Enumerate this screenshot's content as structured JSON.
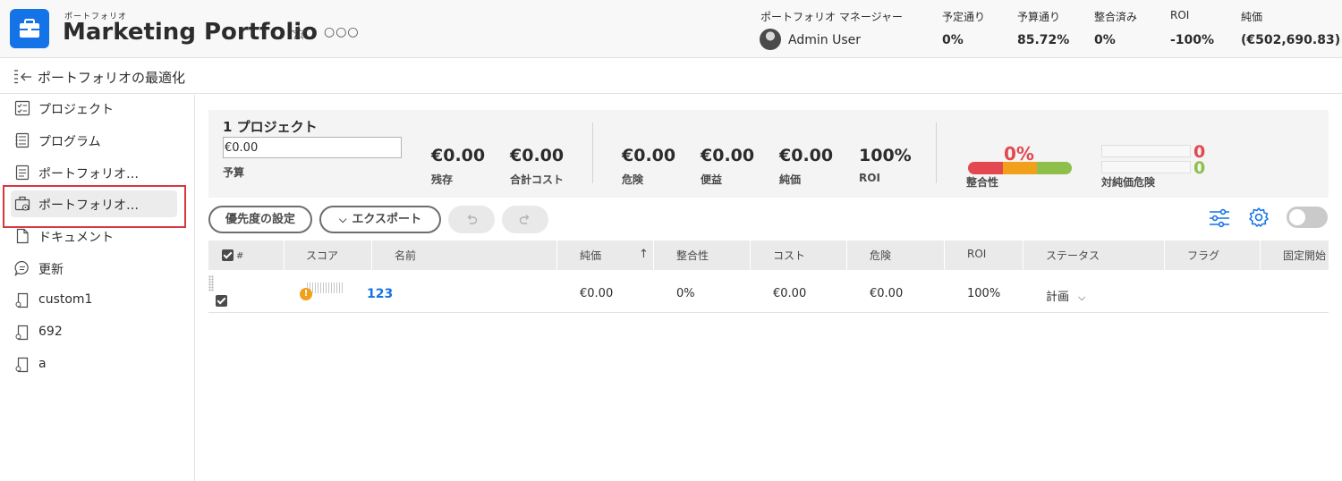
{
  "header": {
    "object_type": "ポートフォリオ",
    "title": "Marketing Portfolio",
    "manager_label": "ポートフォリオ マネージャー",
    "manager_name": "Admin User",
    "stats": [
      {
        "label": "予定通り",
        "value": "0%"
      },
      {
        "label": "予算通り",
        "value": "85.72%"
      },
      {
        "label": "整合済み",
        "value": "0%"
      },
      {
        "label": "ROI",
        "value": "-100%"
      },
      {
        "label": "純価",
        "value": "(€502,690.83)"
      }
    ],
    "icons": {
      "app": "briefcase-icon",
      "favorite": "star-icon",
      "more": "more-icon"
    }
  },
  "subbar": {
    "title": "ポートフォリオの最適化",
    "icon": "collapse-panel-icon"
  },
  "sidebar": {
    "items": [
      {
        "label": "プロジェクト",
        "icon": "project-list-icon"
      },
      {
        "label": "プログラム",
        "icon": "program-icon"
      },
      {
        "label": "ポートフォリオ…",
        "icon": "portfolio-details-icon"
      },
      {
        "label": "ポートフォリオ…",
        "icon": "portfolio-optimizer-icon",
        "active": true
      },
      {
        "label": "ドキュメント",
        "icon": "document-icon"
      },
      {
        "label": "更新",
        "icon": "comment-icon"
      },
      {
        "label": "custom1",
        "icon": "custom-form-icon"
      },
      {
        "label": "692",
        "icon": "custom-form-icon"
      },
      {
        "label": "a",
        "icon": "custom-form-icon"
      }
    ]
  },
  "summary": {
    "project_count": "1 プロジェクト",
    "budget_value": "€0.00",
    "budget_label": "予算",
    "metrics": [
      {
        "value": "€0.00",
        "label": "残存"
      },
      {
        "value": "€0.00",
        "label": "合計コスト"
      },
      {
        "value": "€0.00",
        "label": "危険"
      },
      {
        "value": "€0.00",
        "label": "便益"
      },
      {
        "value": "€0.00",
        "label": "純価"
      },
      {
        "value": "100%",
        "label": "ROI"
      }
    ],
    "alignment": {
      "value": "0%",
      "label": "整合性",
      "colors": [
        "#e34850",
        "#f0a01a",
        "#8fbf4b"
      ]
    },
    "net_risk": {
      "label": "対純価危険",
      "value_a": "0",
      "value_b": "0"
    }
  },
  "toolbar": {
    "set_priority": "優先度の設定",
    "export": "エクスポート",
    "icons": {
      "undo": "undo-icon",
      "redo": "redo-icon",
      "filter": "filter-icon",
      "settings": "gear-icon"
    }
  },
  "table": {
    "headers": [
      "#",
      "スコア",
      "名前",
      "純価",
      "整合性",
      "コスト",
      "危険",
      "ROI",
      "ステータス",
      "フラグ",
      "固定開始"
    ],
    "sort_column": "純価",
    "sort_direction": "ascending",
    "rows": [
      {
        "checked": true,
        "score_icon": "warning-icon",
        "name": "123",
        "net_value": "€0.00",
        "alignment": "0%",
        "cost": "€0.00",
        "risk": "€0.00",
        "roi": "100%",
        "status": "計画",
        "flag": "",
        "fixed_start": ""
      }
    ]
  }
}
